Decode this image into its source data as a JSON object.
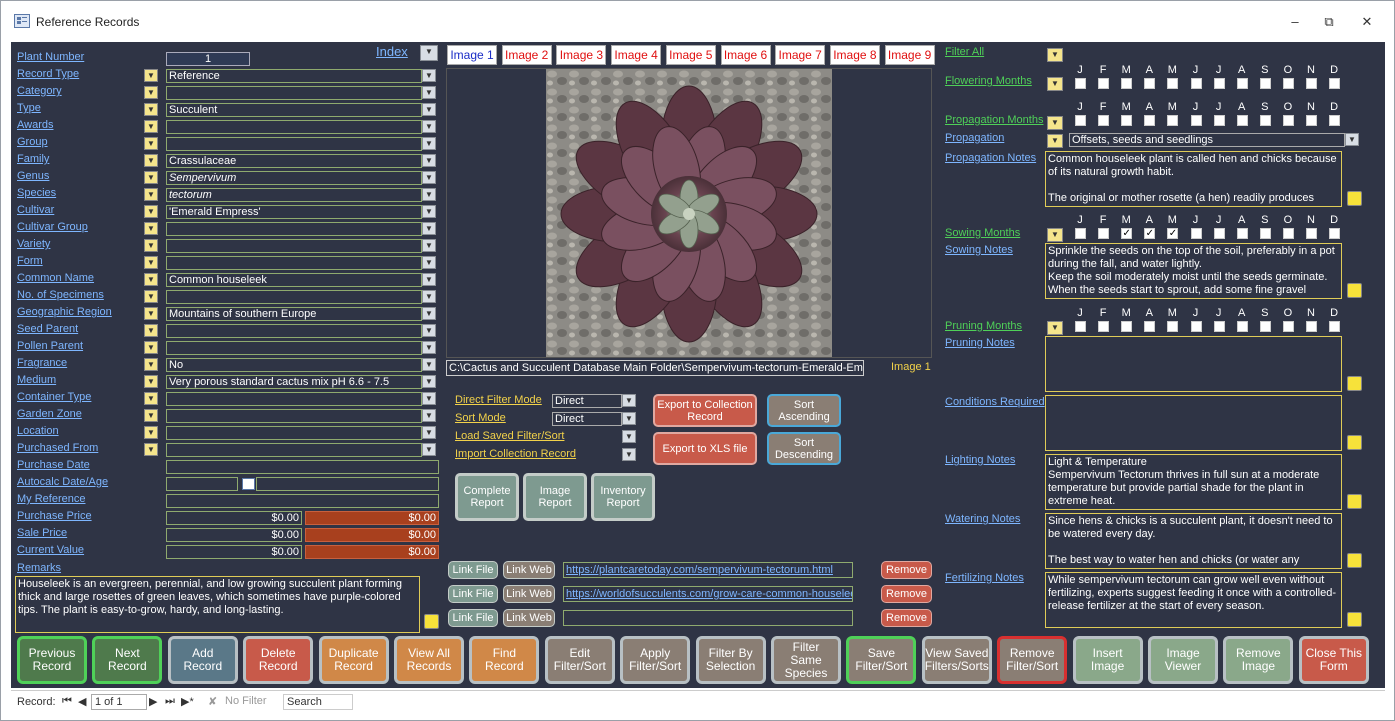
{
  "window": {
    "title": "Reference Records"
  },
  "left": {
    "index_label": "Index",
    "rows": [
      {
        "label": "Plant Number",
        "value": "1"
      },
      {
        "label": "Record Type",
        "value": "Reference"
      },
      {
        "label": "Category",
        "value": ""
      },
      {
        "label": "Type",
        "value": "Succulent"
      },
      {
        "label": "Awards",
        "value": ""
      },
      {
        "label": "Group",
        "value": ""
      },
      {
        "label": "Family",
        "value": "Crassulaceae"
      },
      {
        "label": "Genus",
        "value": "Sempervivum"
      },
      {
        "label": "Species",
        "value": "tectorum"
      },
      {
        "label": "Cultivar",
        "value": "'Emerald Empress'"
      },
      {
        "label": "Cultivar Group",
        "value": ""
      },
      {
        "label": "Variety",
        "value": ""
      },
      {
        "label": "Form",
        "value": ""
      },
      {
        "label": "Common Name",
        "value": "Common houseleek"
      },
      {
        "label": "No. of Specimens",
        "value": ""
      },
      {
        "label": "Geographic Region",
        "value": "Mountains of southern Europe"
      },
      {
        "label": "Seed Parent",
        "value": ""
      },
      {
        "label": "Pollen Parent",
        "value": ""
      },
      {
        "label": "Fragrance",
        "value": "No"
      },
      {
        "label": "Medium",
        "value": "Very porous standard cactus mix pH 6.6 - 7.5"
      },
      {
        "label": "Container Type",
        "value": ""
      },
      {
        "label": "Garden Zone",
        "value": ""
      },
      {
        "label": "Location",
        "value": ""
      },
      {
        "label": "Purchased From",
        "value": ""
      },
      {
        "label": "Purchase Date",
        "value": ""
      },
      {
        "label": "Autocalc Date/Age",
        "value": ""
      },
      {
        "label": "My Reference",
        "value": ""
      }
    ],
    "prices": [
      {
        "label": "Purchase Price",
        "value": "$0.00",
        "value2": "$0.00"
      },
      {
        "label": "Sale Price",
        "value": "$0.00",
        "value2": "$0.00"
      },
      {
        "label": "Current Value",
        "value": "$0.00",
        "value2": "$0.00"
      }
    ],
    "remarks_label": "Remarks",
    "remarks": "Houseleek is an evergreen, perennial, and low growing succulent plant forming thick and large rosettes of green leaves, which sometimes have purple-colored tips. The plant is easy-to-grow, hardy, and long-lasting."
  },
  "image_tabs": [
    "Image 1",
    "Image 2",
    "Image 3",
    "Image 4",
    "Image 5",
    "Image 6",
    "Image 7",
    "Image 8",
    "Image 9"
  ],
  "image_path": "C:\\Cactus and Succulent Database Main Folder\\Sempervivum-tectorum-Emerald-Empre",
  "image_caption": "Image 1",
  "filters": {
    "direct_filter_label": "Direct Filter Mode",
    "direct_filter_value": "Direct",
    "sort_mode_label": "Sort Mode",
    "sort_mode_value": "Direct",
    "load_saved_label": "Load Saved Filter/Sort",
    "import_label": "Import Collection Record",
    "export_collection": "Export to Collection Record",
    "export_xls": "Export to XLS file",
    "sort_asc": "Sort Ascending",
    "sort_desc": "Sort Descending"
  },
  "reports": [
    "Complete Report",
    "Image Report",
    "Inventory Report"
  ],
  "links": [
    {
      "url": "https://plantcaretoday.com/sempervivum-tectorum.html"
    },
    {
      "url": "https://worldofsucculents.com/grow-care-common-houseleek/"
    },
    {
      "url": ""
    }
  ],
  "link_file": "Link File",
  "link_web": "Link Web",
  "remove": "Remove",
  "right": {
    "filter_all": "Filter All",
    "months": [
      "J",
      "F",
      "M",
      "A",
      "M",
      "J",
      "J",
      "A",
      "S",
      "O",
      "N",
      "D"
    ],
    "flowering": "Flowering Months",
    "propagation_months": "Propagation Months",
    "propagation_label": "Propagation",
    "propagation_value": "Offsets, seeds and seedlings",
    "propagation_notes_label": "Propagation Notes",
    "propagation_notes": "Common houseleek plant is called hen and chicks because of its natural growth habit.\n\nThe original or mother rosette (a hen) readily produces",
    "sowing_months": "Sowing Months",
    "sowing_checked": [
      2,
      3,
      4
    ],
    "sowing_notes_label": "Sowing Notes",
    "sowing_notes": "Sprinkle the seeds on the top of the soil, preferably in a pot during the fall, and water lightly.\nKeep the soil moderately moist until the seeds germinate.\nWhen the seeds start to sprout, add some fine gravel",
    "pruning_months": "Pruning Months",
    "pruning_notes_label": "Pruning Notes",
    "pruning_notes": "",
    "conditions_label": "Conditions Required",
    "conditions": "",
    "lighting_label": "Lighting Notes",
    "lighting": "Light & Temperature\nSempervivum Tectorum thrives in full sun at a moderate temperature but provide partial shade for the plant in extreme heat.",
    "watering_label": "Watering Notes",
    "watering": "Since hens & chicks is a succulent plant, it doesn't need to be watered every day.\n\nThe best way to water hen and chicks (or water any",
    "fertilizing_label": "Fertilizing Notes",
    "fertilizing": "While sempervivum tectorum can grow well even without fertilizing, experts suggest feeding it once with a controlled-release fertilizer at the start of every season."
  },
  "bottom_buttons": [
    {
      "label": "Previous Record",
      "color": "#4f7a4c"
    },
    {
      "label": "Next Record",
      "color": "#4f7a4c"
    },
    {
      "label": "Add Record",
      "color": "#5a7888"
    },
    {
      "label": "Delete Record",
      "color": "#c85a4a"
    },
    {
      "label": "Duplicate Record",
      "color": "#d08848"
    },
    {
      "label": "View All Records",
      "color": "#d08848"
    },
    {
      "label": "Find Record",
      "color": "#d08848"
    },
    {
      "label": "Edit Filter/Sort",
      "color": "#8a7e74"
    },
    {
      "label": "Apply Filter/Sort",
      "color": "#8a7e74"
    },
    {
      "label": "Filter By Selection",
      "color": "#8a7e74"
    },
    {
      "label": "Filter Same Species",
      "color": "#8a7e74"
    },
    {
      "label": "Save Filter/Sort",
      "color": "#8a7e74"
    },
    {
      "label": "View Saved Filters/Sorts",
      "color": "#8a7e74"
    },
    {
      "label": "Remove Filter/Sort",
      "color": "#8a7e74"
    },
    {
      "label": "Insert Image",
      "color": "#8aa88a"
    },
    {
      "label": "Image Viewer",
      "color": "#8aa88a"
    },
    {
      "label": "Remove Image",
      "color": "#8aa88a"
    },
    {
      "label": "Close This Form",
      "color": "#c85a4a"
    }
  ],
  "status": {
    "record_label": "Record:",
    "record_value": "1 of 1",
    "no_filter": "No Filter",
    "search": "Search"
  }
}
